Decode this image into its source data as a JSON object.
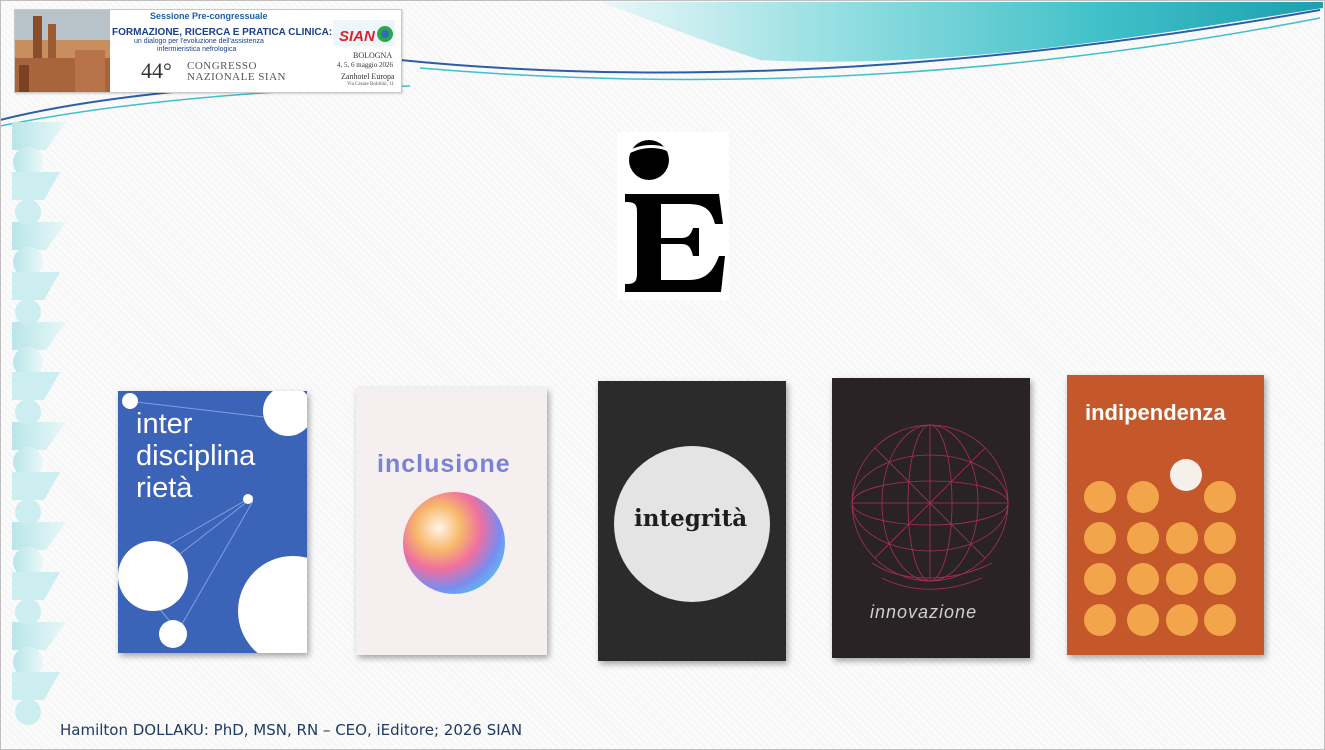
{
  "header": {
    "session": "Sessione Pre-congressuale",
    "title_line1": "FORMAZIONE, RICERCA E PRATICA CLINICA:",
    "title_line2": "un dialogo per l'evoluzione dell'assistenza",
    "title_line3": "infermieristica nefrologica",
    "congress_number": "44°",
    "congress_line1": "CONGRESSO",
    "congress_line2": "NAZIONALE SIAN",
    "sian_logo_text": "SIAN",
    "city": "BOLOGNA",
    "dates": "4, 5, 6 maggio 2026",
    "venue": "Zanhotel Europa",
    "address": "Via Cesare Boldrini, 11"
  },
  "publisher_logo": {
    "icon": "ieditore-logo-icon"
  },
  "books": [
    {
      "line1": "inter",
      "line2": "disciplina",
      "line3": "rietà",
      "color": "#3b63b8"
    },
    {
      "title": "inclusione",
      "color": "#f6eff0"
    },
    {
      "title": "integrità",
      "color": "#2b2b2b"
    },
    {
      "title": "innovazione",
      "color": "#2a2326"
    },
    {
      "title": "indipendenza",
      "color": "#c4582a"
    }
  ],
  "footer": {
    "text": "Hamilton DOLLAKU: PhD, MSN, RN – CEO, iEditore; 2026 SIAN"
  },
  "colors": {
    "wave_teal": "#3fc0c8",
    "wave_blue": "#2a5fa8",
    "footer_text": "#1f3b63"
  }
}
